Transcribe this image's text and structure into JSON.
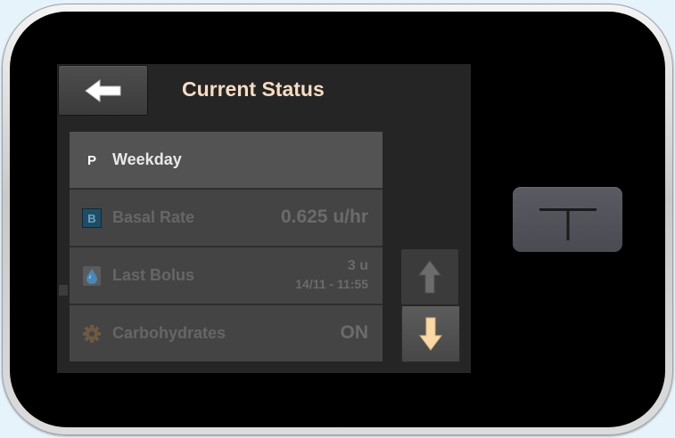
{
  "screen": {
    "title": "Current Status"
  },
  "status_rows": [
    {
      "icon": "profile-letter-icon",
      "icon_text": "P",
      "label": "Weekday"
    },
    {
      "icon": "basal-badge-icon",
      "icon_text": "B",
      "label": "Basal Rate",
      "value": "0.625 u/hr"
    },
    {
      "icon": "drop-icon",
      "label": "Last Bolus",
      "value": "3 u",
      "timestamp": "14/11 - 11:55"
    },
    {
      "icon": "gear-icon",
      "label": "Carbohydrates",
      "value": "ON"
    }
  ],
  "controls": {
    "back": "back-arrow-icon",
    "up": "up-arrow-icon",
    "down": "down-arrow-icon",
    "home": "t-logo-icon"
  },
  "colors": {
    "title": "#f6dcc4",
    "active_arrow": "#fbd9a6",
    "basal_badge": "#1f4d66",
    "drop": "#4a86b8",
    "screen_background": "#252525"
  }
}
